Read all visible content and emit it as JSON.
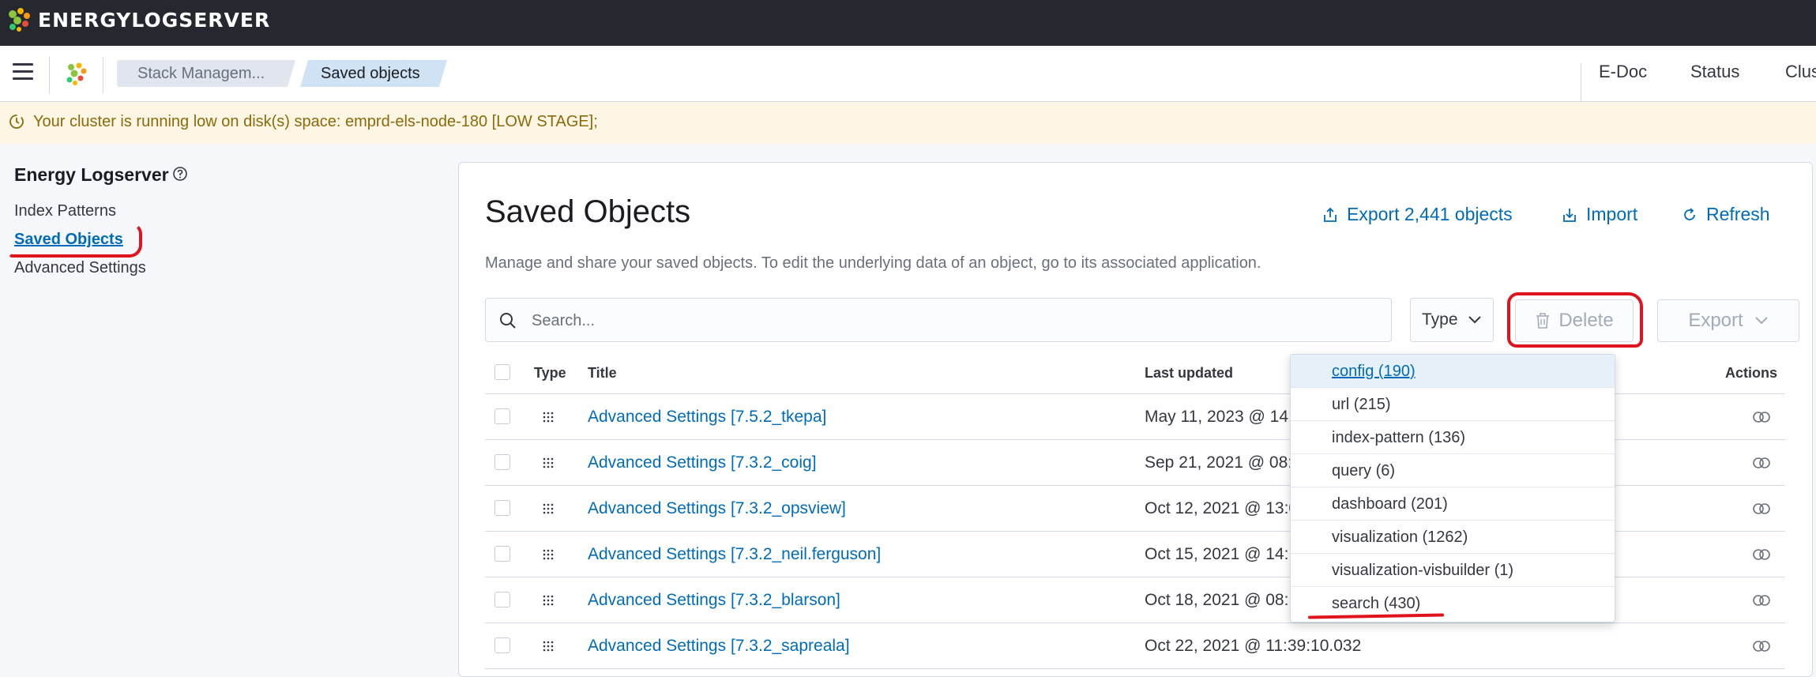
{
  "brand": {
    "name": "ENERGYLOGSERVER"
  },
  "header": {
    "breadcrumbs": [
      "Stack Managem...",
      "Saved objects"
    ],
    "links": [
      "E-Doc",
      "Status",
      "Clus"
    ]
  },
  "callout": {
    "text": "Your cluster is running low on disk(s) space: emprd-els-node-180 [LOW STAGE];"
  },
  "sidebar": {
    "title": "Energy Logserver",
    "items": [
      {
        "label": "Index Patterns"
      },
      {
        "label": "Saved Objects",
        "active": true
      },
      {
        "label": "Advanced Settings"
      }
    ]
  },
  "main": {
    "title": "Saved Objects",
    "export_all": "Export 2,441 objects",
    "import": "Import",
    "refresh": "Refresh",
    "description": "Manage and share your saved objects. To edit the underlying data of an object, go to its associated application.",
    "search_placeholder": "Search...",
    "type_filter": "Type",
    "delete": "Delete",
    "export": "Export"
  },
  "table": {
    "headers": [
      "Type",
      "Title",
      "Last updated",
      "Actions"
    ],
    "rows": [
      {
        "title": "Advanced Settings [7.5.2_tkepa]",
        "updated": "May 11, 2023 @ 14:"
      },
      {
        "title": "Advanced Settings [7.3.2_coig]",
        "updated": "Sep 21, 2021 @ 08:"
      },
      {
        "title": "Advanced Settings [7.3.2_opsview]",
        "updated": "Oct 12, 2021 @ 13:0"
      },
      {
        "title": "Advanced Settings [7.3.2_neil.ferguson]",
        "updated": "Oct 15, 2021 @ 14:1"
      },
      {
        "title": "Advanced Settings [7.3.2_blarson]",
        "updated": "Oct 18, 2021 @ 08:1"
      },
      {
        "title": "Advanced Settings [7.3.2_sapreala]",
        "updated": "Oct 22, 2021 @ 11:39:10.032"
      }
    ]
  },
  "type_dropdown": {
    "options": [
      "config (190)",
      "url (215)",
      "index-pattern (136)",
      "query (6)",
      "dashboard (201)",
      "visualization (1262)",
      "visualization-visbuilder (1)",
      "search (430)"
    ]
  },
  "colors": {
    "accent": "#006bb8",
    "annotation": "#e0141e",
    "topbar": "#25282f",
    "warning_bg": "#fef6e5"
  }
}
